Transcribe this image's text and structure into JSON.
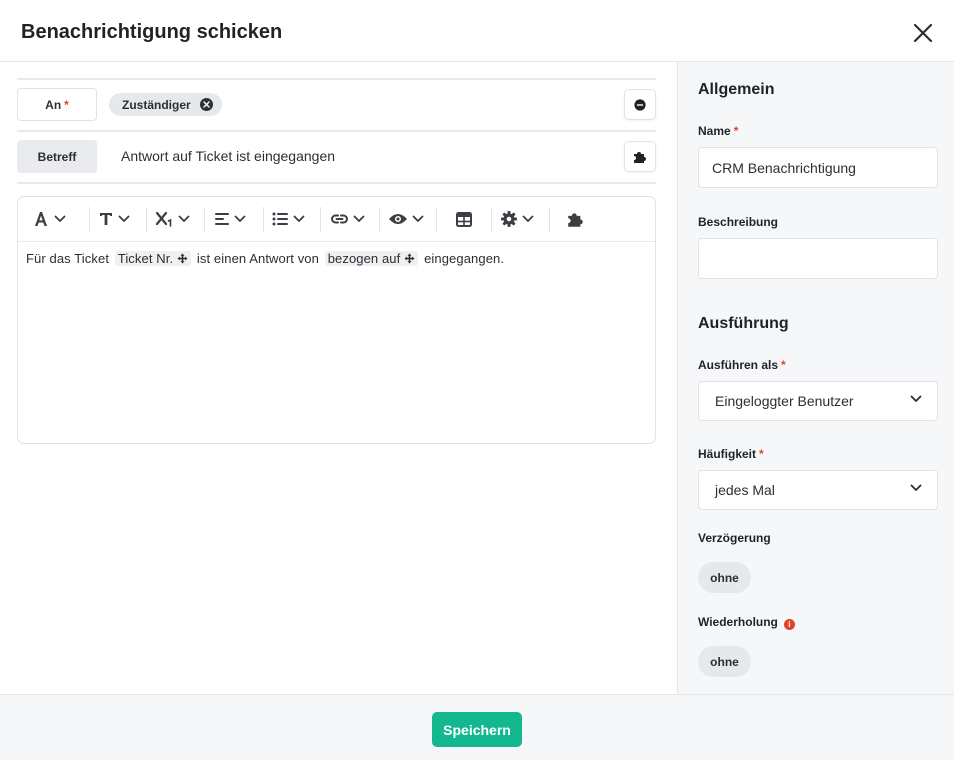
{
  "dialog": {
    "title": "Benachrichtigung schicken"
  },
  "recipient": {
    "label": "An",
    "required_mark": "*",
    "chips": [
      "Zuständiger"
    ]
  },
  "subject": {
    "label": "Betreff",
    "value": "Antwort auf Ticket ist eingegangen"
  },
  "editor": {
    "body": {
      "t1": "Für das Ticket",
      "token1": "Ticket Nr.",
      "t2": "ist einen Antwort von",
      "token2": "bezogen auf",
      "t3": "eingegangen."
    }
  },
  "general": {
    "title": "Allgemein",
    "name_label": "Name",
    "name_value": "CRM Benachrichtigung",
    "description_label": "Beschreibung",
    "description_value": ""
  },
  "execution": {
    "title": "Ausführung",
    "run_as_label": "Ausführen als",
    "run_as_value": "Eingeloggter Benutzer",
    "frequency_label": "Häufigkeit",
    "frequency_value": "jedes Mal",
    "delay_label": "Verzögerung",
    "delay_value": "ohne",
    "repeat_label": "Wiederholung",
    "repeat_value": "ohne"
  },
  "footer": {
    "save_label": "Speichern"
  },
  "colors": {
    "accent": "#14b88e",
    "required": "#e0442b"
  }
}
